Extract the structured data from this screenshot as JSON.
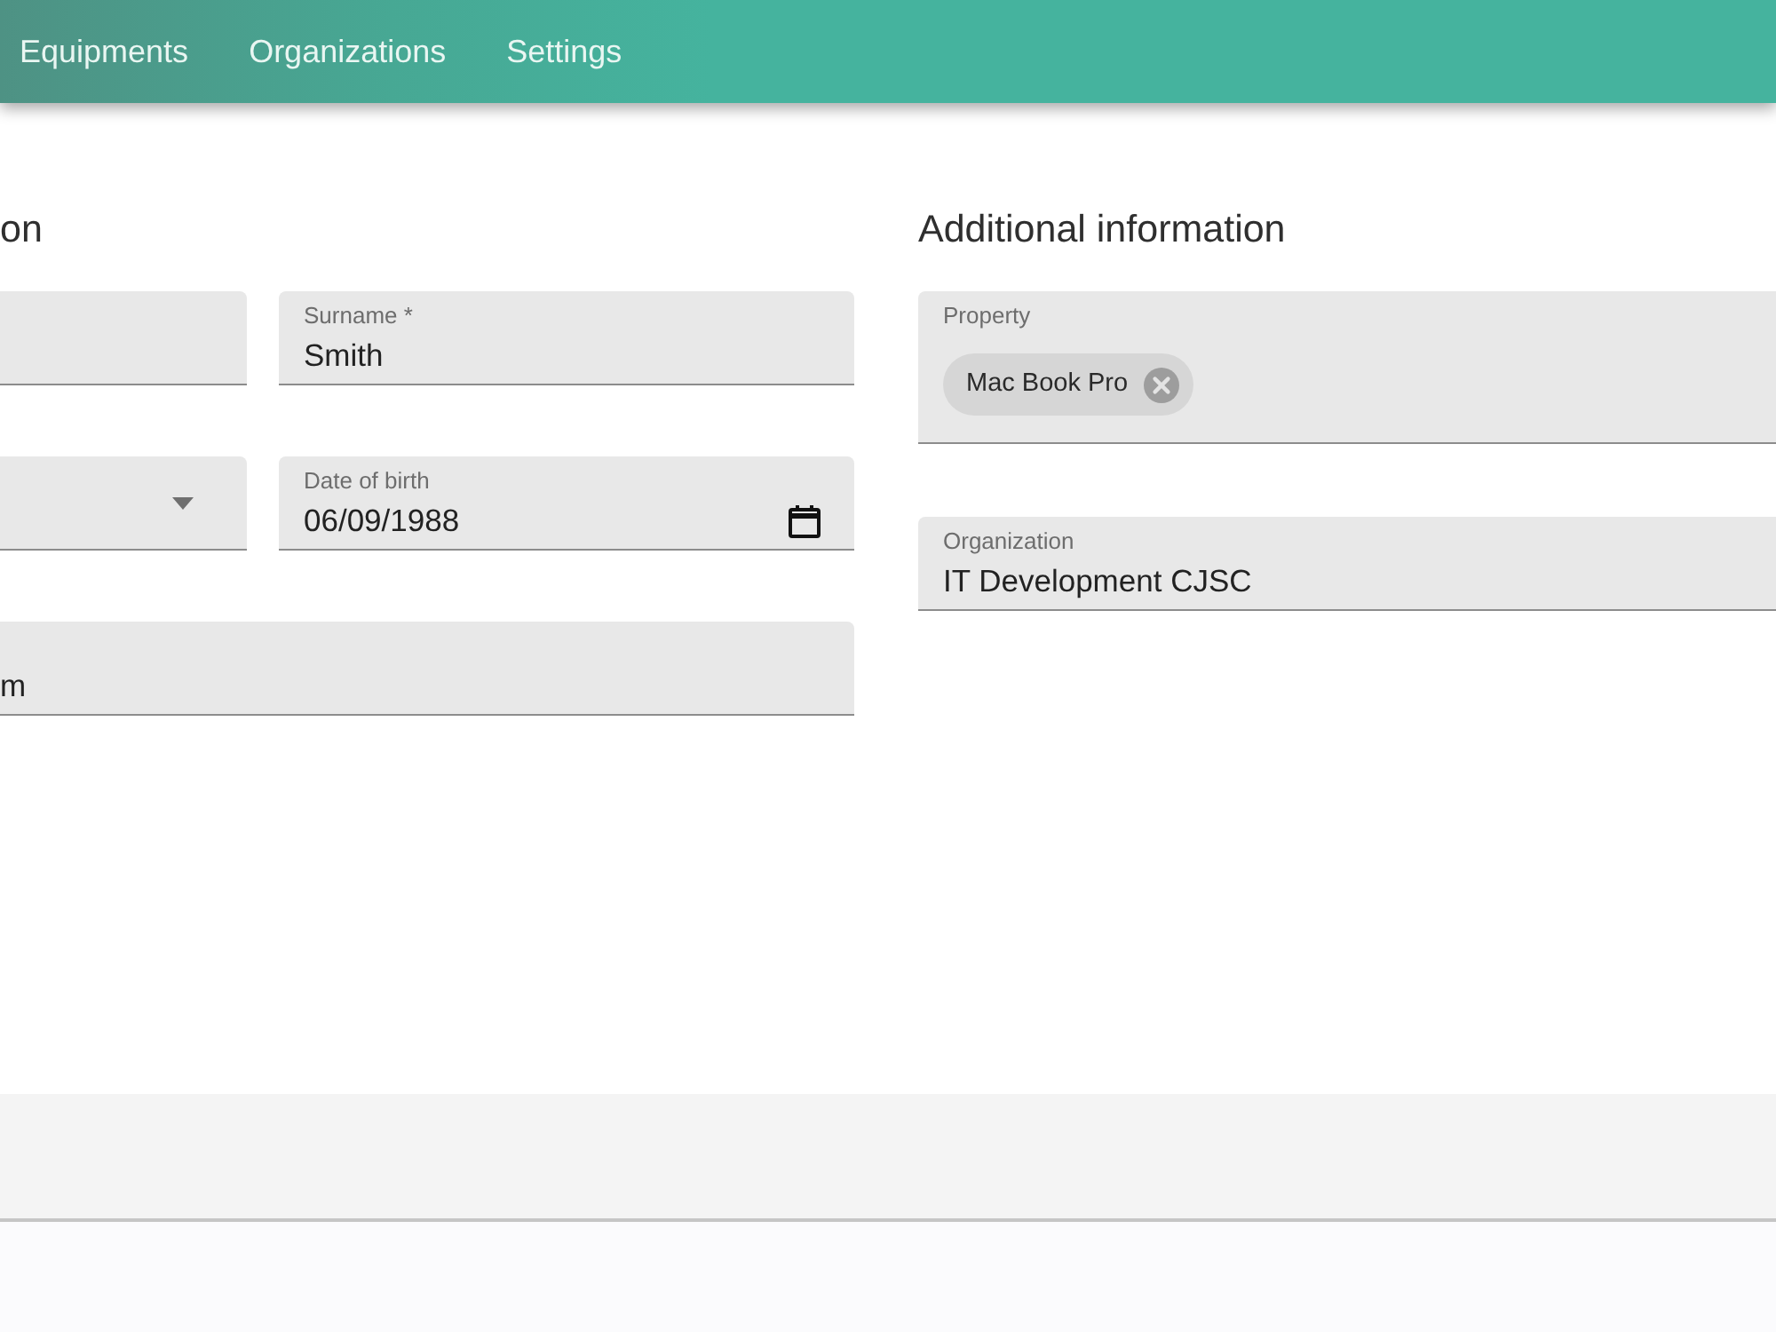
{
  "nav": {
    "items": [
      {
        "label": "Equipments"
      },
      {
        "label": "Organizations"
      },
      {
        "label": "Settings"
      }
    ]
  },
  "sections": [
    {
      "title": "on",
      "rows": [
        [
          {
            "kind": "text"
          },
          {
            "kind": "text",
            "label": "Surname *",
            "value": "Smith"
          }
        ],
        [
          {
            "kind": "select"
          },
          {
            "kind": "date",
            "label": "Date of birth",
            "value": "06/09/1988"
          }
        ],
        [
          {
            "kind": "text",
            "value": "m"
          }
        ]
      ]
    },
    {
      "title": "Additional information",
      "rows": [
        [
          {
            "kind": "chips",
            "label": "Property",
            "chips": [
              {
                "label": "Mac Book Pro"
              }
            ]
          }
        ],
        [
          {
            "kind": "text",
            "label": "Organization",
            "value": "IT Development CJSC"
          }
        ]
      ]
    }
  ]
}
